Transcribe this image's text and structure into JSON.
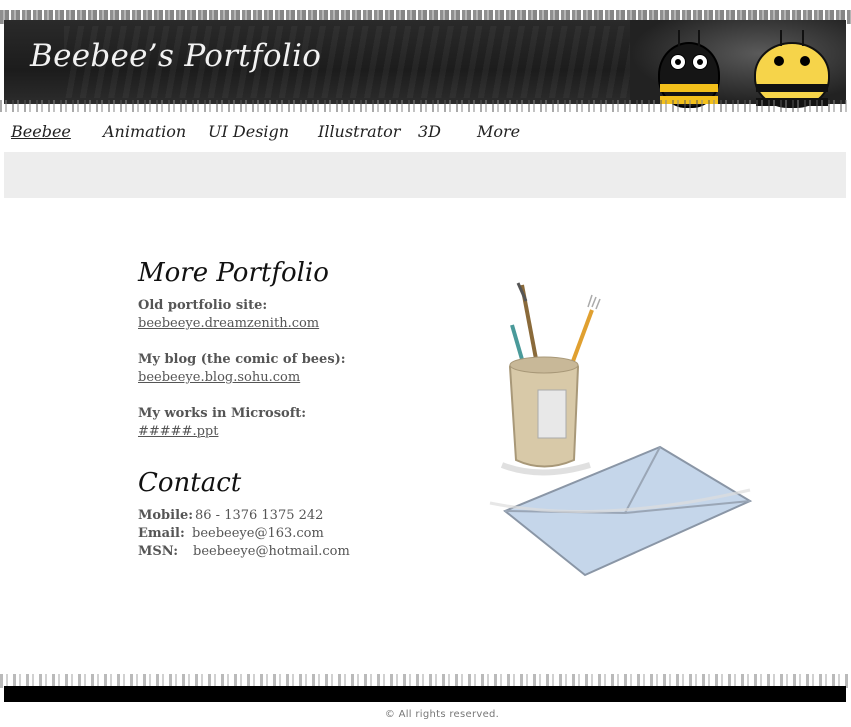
{
  "header": {
    "title": "Beebee’s Portfolio"
  },
  "nav": {
    "items": [
      "Beebee",
      "Animation",
      "UI Design",
      "Illustrator",
      "3D",
      "More"
    ],
    "active_index": 0
  },
  "portfolio": {
    "heading": "More Portfolio",
    "sections": [
      {
        "label": "Old portfolio site:",
        "link": "beebeeye.dreamzenith.com"
      },
      {
        "label": "My blog (the comic of bees):",
        "link": "beebeeye.blog.sohu.com"
      },
      {
        "label": "My works in Microsoft:",
        "link": "#####.ppt"
      }
    ]
  },
  "contact": {
    "heading": "Contact",
    "mobile_label": "Mobile:",
    "mobile_value": "86 - 1376 1375 242",
    "email_label": "Email:",
    "email_value": "beebeeye@163.com",
    "msn_label": "MSN:",
    "msn_value": "beebeeye@hotmail.com"
  },
  "footer": {
    "copyright": "© All rights reserved."
  },
  "colors": {
    "header_bg": "#1c1c1c",
    "gray_bar": "#ededed",
    "bee_yellow": "#f3c01b"
  }
}
